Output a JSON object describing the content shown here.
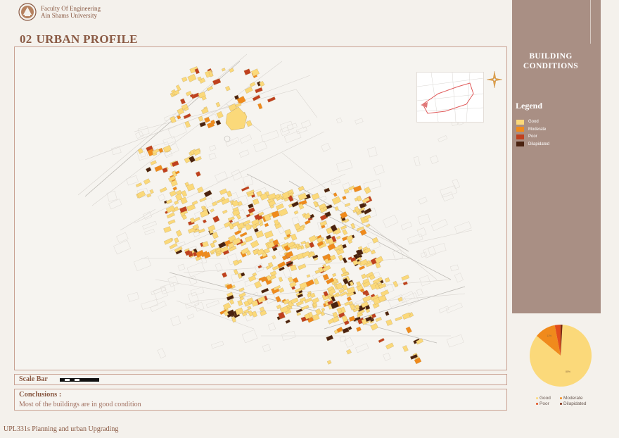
{
  "header": {
    "faculty_line1": "Faculty Of Engineering",
    "faculty_line2": "Ain Shams University",
    "logo_icon": "university-crest-icon",
    "title_number": "02",
    "title_text": "URBAN PROFILE"
  },
  "side_panel": {
    "title_line1": "BUILDING",
    "title_line2": "CONDITIONS",
    "legend_title": "Legend",
    "legend": [
      {
        "label": "Good",
        "color": "#fbd97a"
      },
      {
        "label": "Moderate",
        "color": "#f08a1c"
      },
      {
        "label": "Poor",
        "color": "#c0401f"
      },
      {
        "label": "Dilapidated",
        "color": "#4a2210"
      }
    ]
  },
  "pie_chart": {
    "slices": [
      {
        "label": "Good",
        "value": 85,
        "color": "#fbd97a",
        "text": "85%"
      },
      {
        "label": "Moderate",
        "value": 11,
        "color": "#f08a1c",
        "text": "11%"
      },
      {
        "label": "Poor",
        "value": 3,
        "color": "#e24d1c",
        "text": ""
      },
      {
        "label": "Dilapidated",
        "value": 1,
        "color": "#7a2a10",
        "text": ""
      }
    ]
  },
  "scale": {
    "label": "Scale Bar"
  },
  "conclusions": {
    "title": "Conclusions :",
    "text": "Most of the buildings are in good condition"
  },
  "footer": {
    "course": "UPL331s Planning and urban Upgrading"
  },
  "map": {
    "compass_icon": "compass-rose-icon",
    "key_map": "key-map-thumbnail"
  },
  "colors": {
    "accent": "#8a5a44",
    "panel": "#a98f84",
    "frame": "#c9a293",
    "good": "#fbd97a",
    "moderate": "#f08a1c",
    "poor": "#c0401f",
    "dilapidated": "#4a2210"
  }
}
